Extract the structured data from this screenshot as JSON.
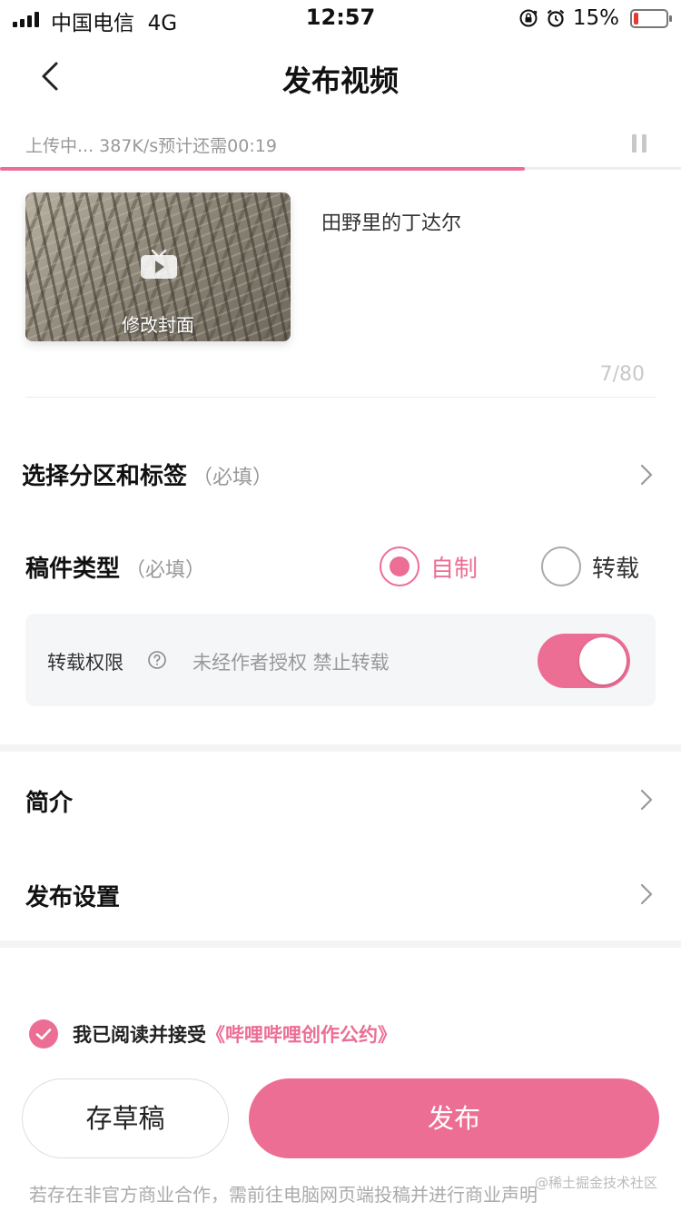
{
  "status_bar": {
    "carrier": "中国电信",
    "network": "4G",
    "time": "12:57",
    "battery": "15%",
    "battery_level": 0.15
  },
  "nav": {
    "title": "发布视频"
  },
  "upload": {
    "status_text": "上传中... 387K/s预计还需00:19",
    "progress": 0.77
  },
  "video": {
    "cover_label": "修改封面",
    "title": "田野里的丁达尔",
    "char_count": "7/80"
  },
  "category": {
    "label": "选择分区和标签",
    "hint": "（必填）"
  },
  "type": {
    "label": "稿件类型",
    "hint": "（必填）",
    "options": [
      "自制",
      "转载"
    ],
    "selected": "自制"
  },
  "permission": {
    "label": "转载权限",
    "description": "未经作者授权 禁止转载",
    "enabled": true
  },
  "intro": {
    "label": "简介"
  },
  "publish_settings": {
    "label": "发布设置"
  },
  "agreement": {
    "text": "我已阅读并接受",
    "link": "《哔哩哔哩创作公约》",
    "checked": true
  },
  "buttons": {
    "draft": "存草稿",
    "publish": "发布"
  },
  "footer_note": "若存在非官方商业合作，需前往电脑网页端投稿并进行商业声明",
  "watermark": "@稀土掘金技术社区",
  "colors": {
    "accent": "#ec6e95",
    "muted": "#999999",
    "panel": "#f5f6f8"
  }
}
